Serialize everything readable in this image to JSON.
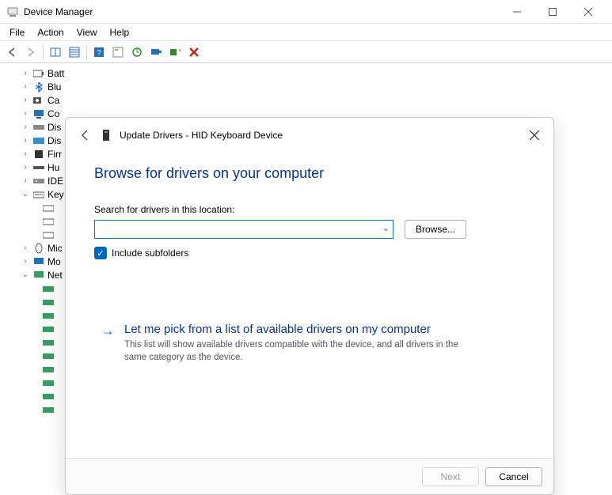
{
  "window": {
    "title": "Device Manager"
  },
  "menu": {
    "file": "File",
    "action": "Action",
    "view": "View",
    "help": "Help"
  },
  "tree": {
    "items": [
      {
        "arrow": "›",
        "label": "Batt"
      },
      {
        "arrow": "›",
        "label": "Blu"
      },
      {
        "arrow": "›",
        "label": "Ca"
      },
      {
        "arrow": "›",
        "label": "Co"
      },
      {
        "arrow": "›",
        "label": "Dis"
      },
      {
        "arrow": "›",
        "label": "Dis"
      },
      {
        "arrow": "›",
        "label": "Firr"
      },
      {
        "arrow": "›",
        "label": "Hu"
      },
      {
        "arrow": "›",
        "label": "IDE"
      },
      {
        "arrow": "⌄",
        "label": "Key"
      }
    ],
    "kb_children": [
      "",
      "",
      ""
    ],
    "items2": [
      {
        "arrow": "›",
        "label": "Mic"
      },
      {
        "arrow": "›",
        "label": "Mo"
      },
      {
        "arrow": "⌄",
        "label": "Net"
      }
    ],
    "net_children": [
      "",
      "",
      "",
      "",
      "",
      "",
      "",
      "",
      "",
      ""
    ]
  },
  "dialog": {
    "title": "Update Drivers - HID Keyboard Device",
    "heading": "Browse for drivers on your computer",
    "search_label": "Search for drivers in this location:",
    "path_value": "",
    "browse_label": "Browse...",
    "include_subfolders": "Include subfolders",
    "link_title": "Let me pick from a list of available drivers on my computer",
    "link_desc": "This list will show available drivers compatible with the device, and all drivers in the same category as the device.",
    "next": "Next",
    "cancel": "Cancel"
  }
}
